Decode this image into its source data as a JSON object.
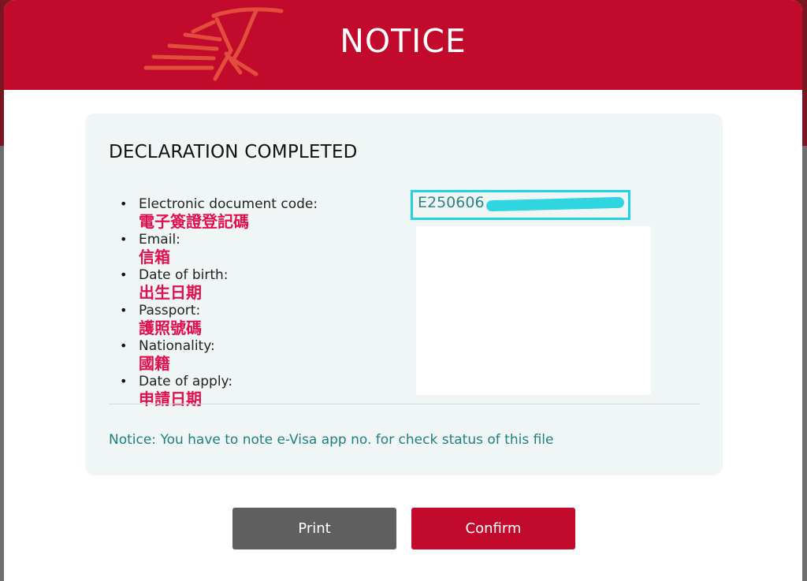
{
  "header": {
    "title": "NOTICE",
    "accent_color": "#c20a2d",
    "logo_icon": "crane-bird-icon"
  },
  "panel": {
    "title": "DECLARATION COMPLETED",
    "fields": [
      {
        "label": "Electronic document code:",
        "note_zh": "電子簽證登記碼"
      },
      {
        "label": "Email:",
        "note_zh": "信箱"
      },
      {
        "label": "Date of birth:",
        "note_zh": "出生日期"
      },
      {
        "label": "Passport:",
        "note_zh": "護照號碼"
      },
      {
        "label": "Nationality:",
        "note_zh": "國籍"
      },
      {
        "label": "Date of apply:",
        "note_zh": "申請日期"
      }
    ],
    "document_code_visible": "E250606",
    "highlight_color": "#22d3e6",
    "notice": "Notice: You have to note e-Visa app no. for check status of this file"
  },
  "buttons": {
    "print_label": "Print",
    "confirm_label": "Confirm"
  }
}
